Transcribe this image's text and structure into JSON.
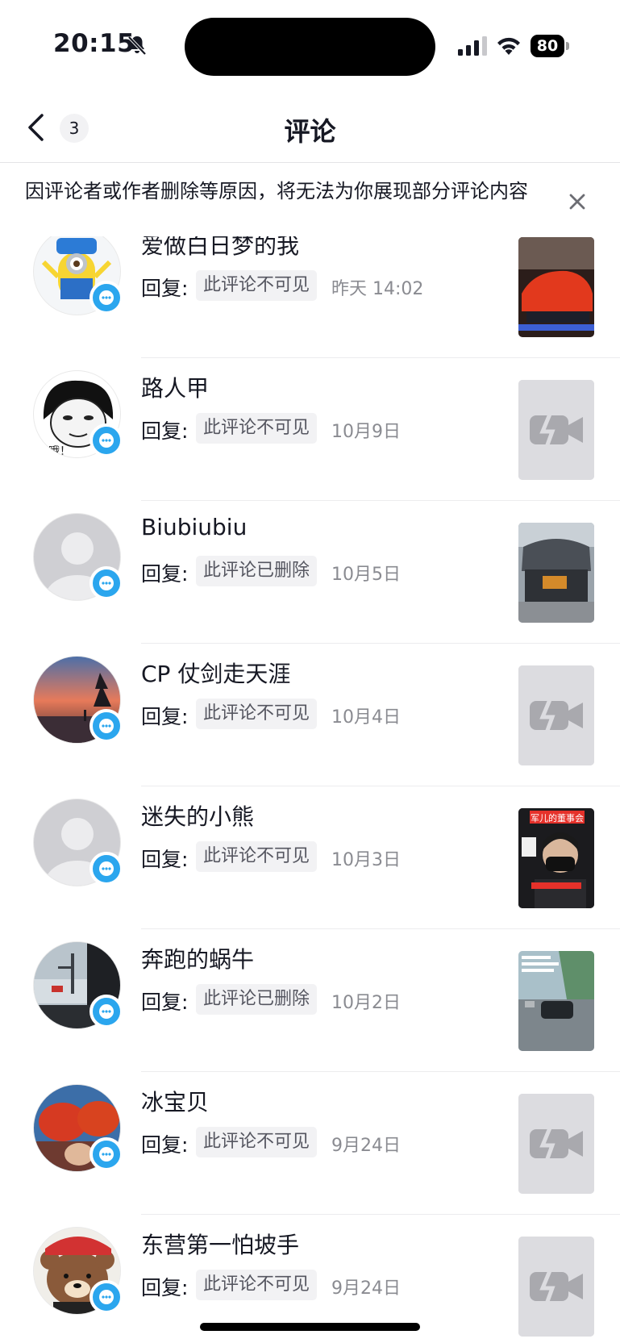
{
  "status_bar": {
    "time": "20:15",
    "battery": "80"
  },
  "nav": {
    "title": "评论",
    "back_count": "3"
  },
  "notice": {
    "text": "因评论者或作者删除等原因，将无法为你展现部分评论内容"
  },
  "comments": [
    {
      "name": "爱做白日梦的我",
      "reply_label": "回复:",
      "reply_status": "此评论不可见",
      "date": "昨天 14:02"
    },
    {
      "name": "路人甲",
      "reply_label": "回复:",
      "reply_status": "此评论不可见",
      "date": "10月9日"
    },
    {
      "name": "Biubiubiu",
      "reply_label": "回复:",
      "reply_status": "此评论已删除",
      "date": "10月5日"
    },
    {
      "name": "CP 仗剑走天涯",
      "reply_label": "回复:",
      "reply_status": "此评论不可见",
      "date": "10月4日"
    },
    {
      "name": "迷失的小熊",
      "reply_label": "回复:",
      "reply_status": "此评论不可见",
      "date": "10月3日"
    },
    {
      "name": "奔跑的蜗牛",
      "reply_label": "回复:",
      "reply_status": "此评论已删除",
      "date": "10月2日"
    },
    {
      "name": "冰宝贝",
      "reply_label": "回复:",
      "reply_status": "此评论不可见",
      "date": "9月24日"
    },
    {
      "name": "东营第一怕坡手",
      "reply_label": "回复:",
      "reply_status": "此评论不可见",
      "date": "9月24日"
    }
  ],
  "thumb_overlay": {
    "text": "军儿的董事会"
  },
  "colors": {
    "accent_blue": "#2ba6ee",
    "text_primary": "#161823",
    "text_secondary": "#8a8b91",
    "tag_bg": "#f2f2f4"
  }
}
